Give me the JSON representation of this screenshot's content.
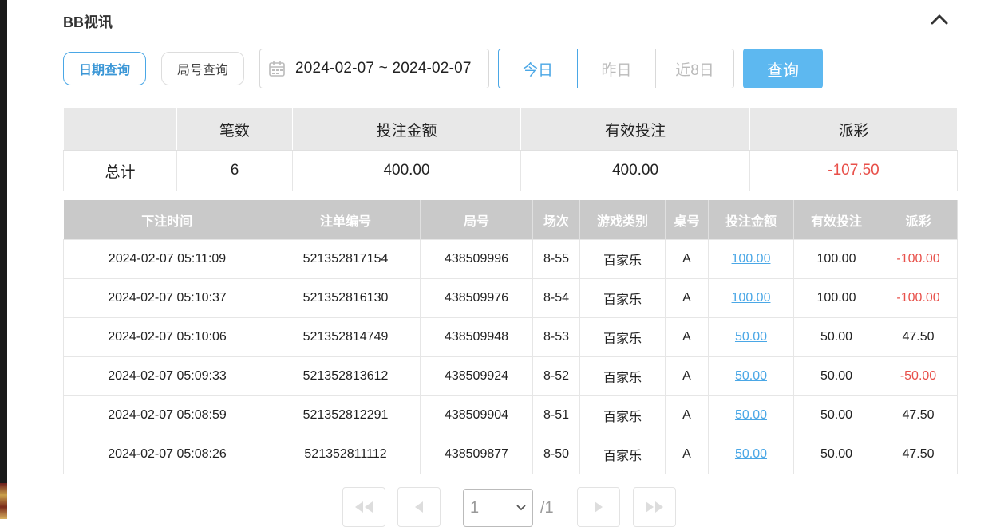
{
  "section": {
    "title": "BB视讯"
  },
  "filters": {
    "date_query_label": "日期查询",
    "round_query_label": "局号查询",
    "date_range": "2024-02-07 ~ 2024-02-07",
    "today_label": "今日",
    "yesterday_label": "昨日",
    "last8_label": "近8日",
    "query_label": "查询"
  },
  "summary": {
    "headers": [
      "",
      "笔数",
      "投注金额",
      "有效投注",
      "派彩"
    ],
    "row": {
      "label": "总计",
      "count": "6",
      "bet": "400.00",
      "valid": "400.00",
      "payout": "-107.50"
    }
  },
  "detail": {
    "headers": [
      "下注时间",
      "注单编号",
      "局号",
      "场次",
      "游戏类别",
      "桌号",
      "投注金额",
      "有效投注",
      "派彩"
    ],
    "rows": [
      {
        "time": "2024-02-07 05:11:09",
        "ticket": "521352817154",
        "round": "438509996",
        "session": "8-55",
        "game": "百家乐",
        "table": "A",
        "bet": "100.00",
        "valid": "100.00",
        "payout": "-100.00"
      },
      {
        "time": "2024-02-07 05:10:37",
        "ticket": "521352816130",
        "round": "438509976",
        "session": "8-54",
        "game": "百家乐",
        "table": "A",
        "bet": "100.00",
        "valid": "100.00",
        "payout": "-100.00"
      },
      {
        "time": "2024-02-07 05:10:06",
        "ticket": "521352814749",
        "round": "438509948",
        "session": "8-53",
        "game": "百家乐",
        "table": "A",
        "bet": "50.00",
        "valid": "50.00",
        "payout": "47.50"
      },
      {
        "time": "2024-02-07 05:09:33",
        "ticket": "521352813612",
        "round": "438509924",
        "session": "8-52",
        "game": "百家乐",
        "table": "A",
        "bet": "50.00",
        "valid": "50.00",
        "payout": "-50.00"
      },
      {
        "time": "2024-02-07 05:08:59",
        "ticket": "521352812291",
        "round": "438509904",
        "session": "8-51",
        "game": "百家乐",
        "table": "A",
        "bet": "50.00",
        "valid": "50.00",
        "payout": "47.50"
      },
      {
        "time": "2024-02-07 05:08:26",
        "ticket": "521352811112",
        "round": "438509877",
        "session": "8-50",
        "game": "百家乐",
        "table": "A",
        "bet": "50.00",
        "valid": "50.00",
        "payout": "47.50"
      }
    ]
  },
  "pager": {
    "page": "1",
    "total": "/1"
  },
  "colors": {
    "accent": "#4aa7e6",
    "negative": "#e8504a",
    "query_button": "#5db8f0",
    "table_header": "#c9c9c9"
  }
}
